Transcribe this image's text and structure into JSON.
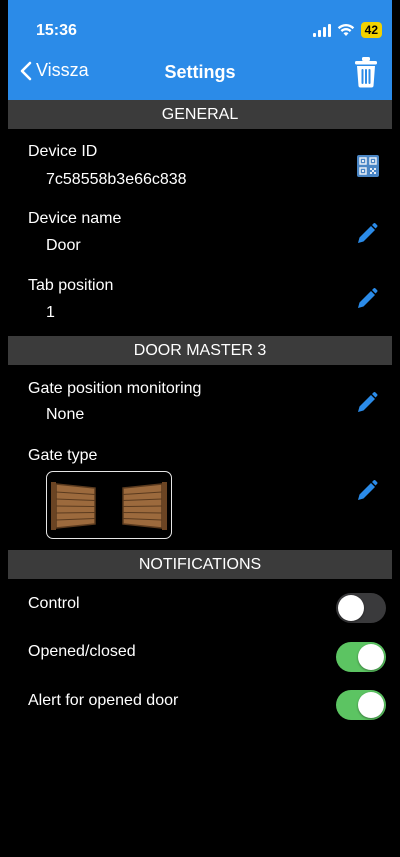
{
  "status_bar": {
    "time": "15:36",
    "battery": "42"
  },
  "nav": {
    "back_label": "Vissza",
    "title": "Settings"
  },
  "sections": {
    "general": "GENERAL",
    "door_master": "DOOR MASTER 3",
    "notifications": "NOTIFICATIONS"
  },
  "general": {
    "device_id_label": "Device ID",
    "device_id_value": "7c58558b3e66c838",
    "device_name_label": "Device name",
    "device_name_value": "Door",
    "tab_position_label": "Tab position",
    "tab_position_value": "1"
  },
  "door_master": {
    "gate_monitoring_label": "Gate position monitoring",
    "gate_monitoring_value": "None",
    "gate_type_label": "Gate type"
  },
  "notifications": {
    "control_label": "Control",
    "opened_closed_label": "Opened/closed",
    "alert_label": "Alert for opened door"
  },
  "colors": {
    "accent": "#2b8be8",
    "section_bg": "#3b3b3b",
    "toggle_on": "#5cc462",
    "toggle_off": "#3a3a3c",
    "battery": "#f2d200"
  },
  "icons": {
    "back": "chevron-left-icon",
    "trash": "trash-icon",
    "qr": "qr-code-icon",
    "edit": "pencil-icon",
    "gate": "swing-gate-icon"
  }
}
